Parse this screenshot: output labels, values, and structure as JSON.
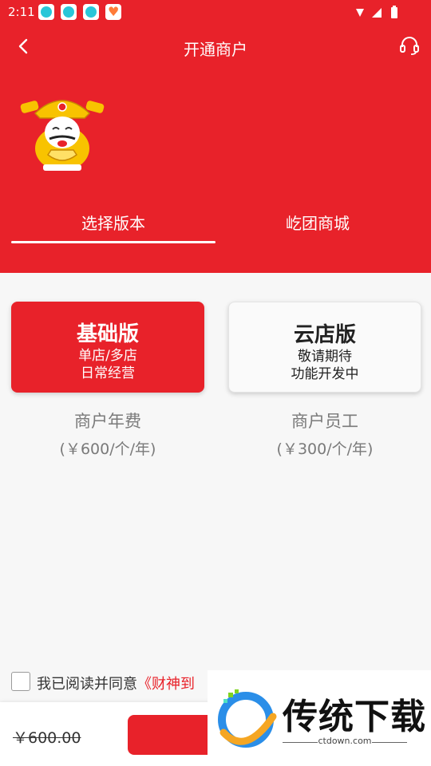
{
  "status_bar": {
    "time": "2:11"
  },
  "header": {
    "title": "开通商户"
  },
  "tabs": [
    {
      "label": "选择版本",
      "active": true
    },
    {
      "label": "屹团商城",
      "active": false
    }
  ],
  "plans": [
    {
      "title": "基础版",
      "line1": "单店/多店",
      "line2": "日常经营",
      "selected": true
    },
    {
      "title": "云店版",
      "line1": "敬请期待",
      "line2": "功能开发中",
      "selected": false
    }
  ],
  "fees": [
    {
      "label": "商户年费",
      "price": "(￥600/个/年)"
    },
    {
      "label": "商户员工",
      "price": "(￥300/个/年)"
    }
  ],
  "agreement": {
    "prefix": "我已阅读并同意",
    "link": "《财神到",
    "checked": false
  },
  "bottom": {
    "old_price": "￥600.00"
  },
  "watermark": {
    "brand": "传统下载",
    "url": "ctdown.com"
  },
  "colors": {
    "primary": "#e8222a",
    "muted_text": "#7a7a7a"
  }
}
